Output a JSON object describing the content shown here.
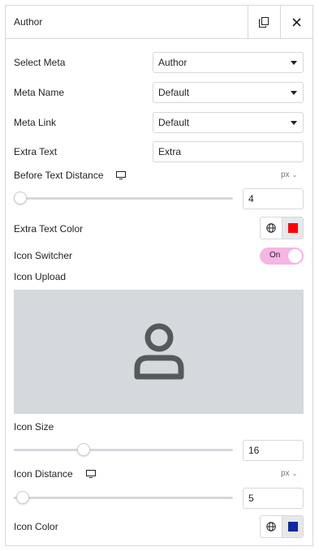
{
  "header": {
    "title": "Author",
    "copy_icon": "copy-icon",
    "close_icon": "close-icon"
  },
  "controls": {
    "select_meta": {
      "label": "Select Meta",
      "value": "Author"
    },
    "meta_name": {
      "label": "Meta Name",
      "value": "Default"
    },
    "meta_link": {
      "label": "Meta Link",
      "value": "Default"
    },
    "extra_text": {
      "label": "Extra Text",
      "value": "Extra"
    },
    "before_text_distance": {
      "label": "Before Text Distance",
      "unit": "px",
      "value": "4",
      "slider_fraction": 0.0
    },
    "extra_text_color": {
      "label": "Extra Text Color",
      "color": "#ff0000"
    },
    "icon_switcher": {
      "label": "Icon Switcher",
      "state": "On",
      "color": "#f6b5e4"
    },
    "icon_upload": {
      "label": "Icon Upload",
      "placeholder_icon": "user-icon"
    },
    "icon_size": {
      "label": "Icon Size",
      "value": "16",
      "slider_fraction": 0.32
    },
    "icon_distance": {
      "label": "Icon Distance",
      "unit": "px",
      "value": "5",
      "slider_fraction": 0.01
    },
    "icon_color": {
      "label": "Icon Color",
      "color": "#0a2aa0"
    }
  }
}
